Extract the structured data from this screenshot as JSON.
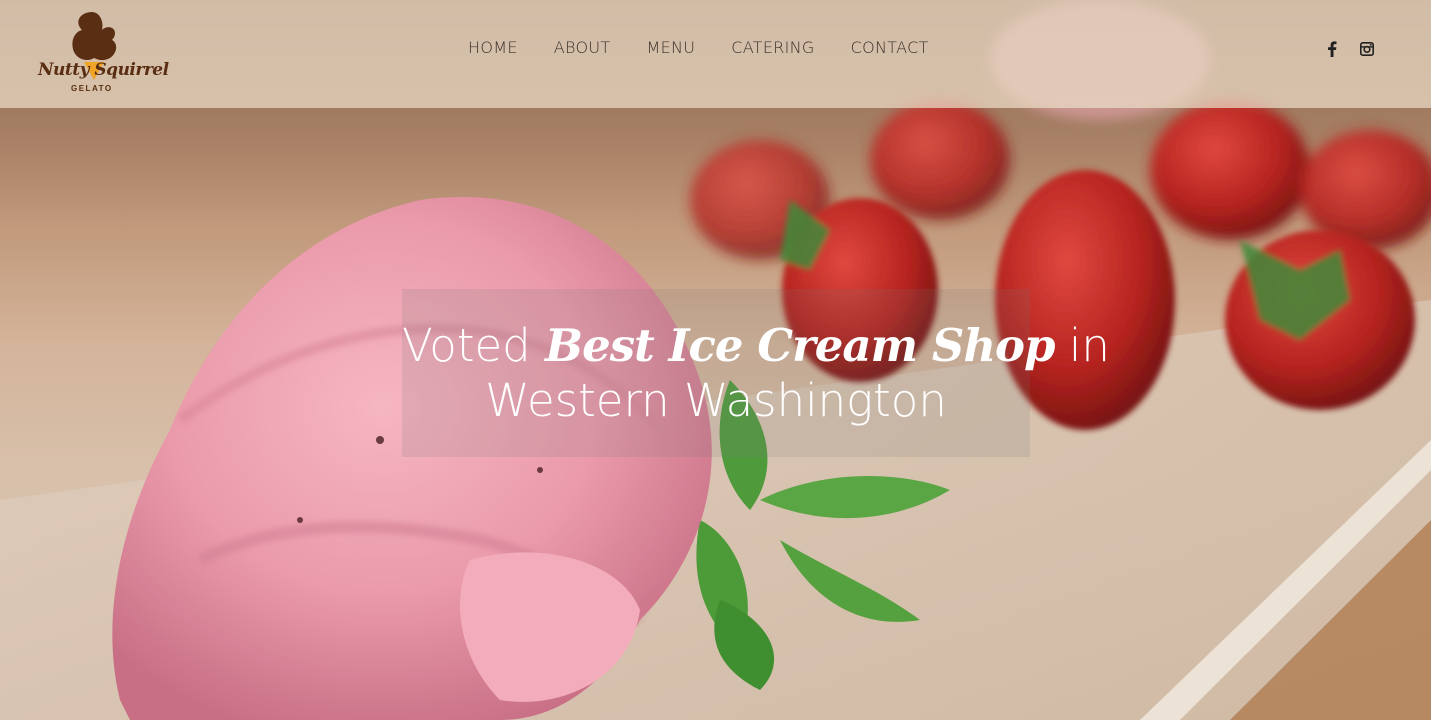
{
  "brand": {
    "name_line": "Nutty Squirrel",
    "sub": "GELATO"
  },
  "nav": {
    "items": [
      "HOME",
      "ABOUT",
      "MENU",
      "CATERING",
      "CONTACT"
    ]
  },
  "social": {
    "facebook_icon": "facebook-icon",
    "instagram_icon": "instagram-icon"
  },
  "hero": {
    "line1_before": "Voted ",
    "line1_script": "Best Ice Cream Shop",
    "line1_after": " in",
    "line2": "Western Washington"
  },
  "colors": {
    "header_bg": "#ecdcc8",
    "nav_text": "#3a302a",
    "brand_brown": "#5a2e12",
    "headline_text": "#ffffff"
  }
}
